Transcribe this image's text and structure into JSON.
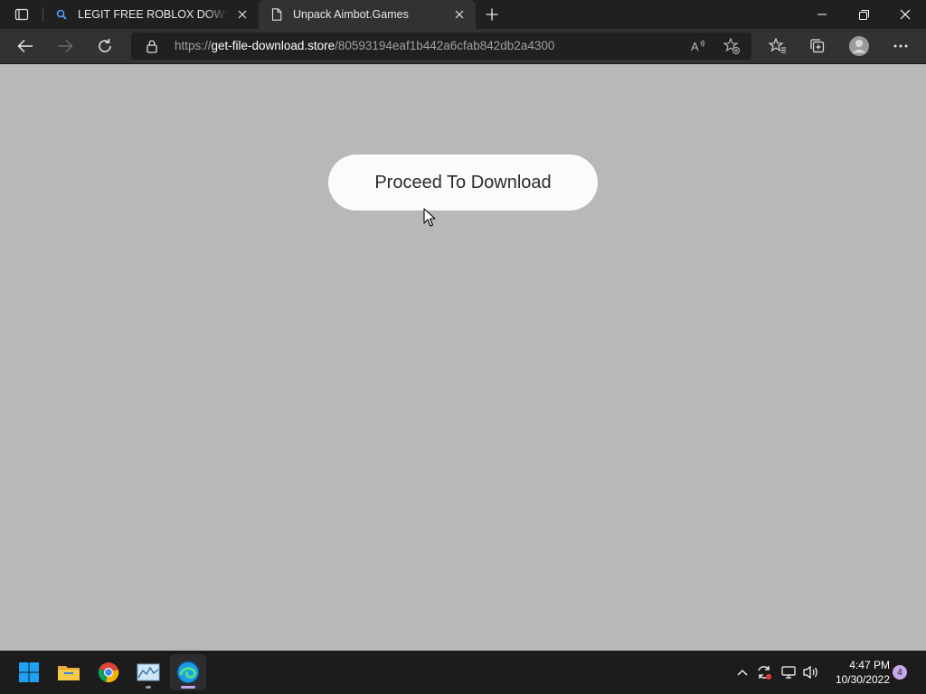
{
  "browser": {
    "tabs": [
      {
        "title": "LEGIT FREE ROBLOX DOWNLOAD",
        "favicon": "search-icon",
        "active": false
      },
      {
        "title": "Unpack Aimbot.Games",
        "favicon": "page-icon",
        "active": true
      }
    ],
    "address": {
      "scheme": "https://",
      "host": "get-file-download.store",
      "path": "/80593194eaf1b442a6cfab842db2a4300"
    }
  },
  "page": {
    "button_label": "Proceed To Download"
  },
  "taskbar": {
    "apps": [
      "start-icon",
      "file-explorer-icon",
      "chrome-icon",
      "task-manager-icon",
      "edge-icon"
    ],
    "time": "4:47 PM",
    "date": "10/30/2022",
    "notification_count": "4"
  },
  "colors": {
    "page_background": "#b8b8b8",
    "button_background": "#fbfbfb",
    "tab_strip": "#202020",
    "toolbar": "#323232"
  }
}
